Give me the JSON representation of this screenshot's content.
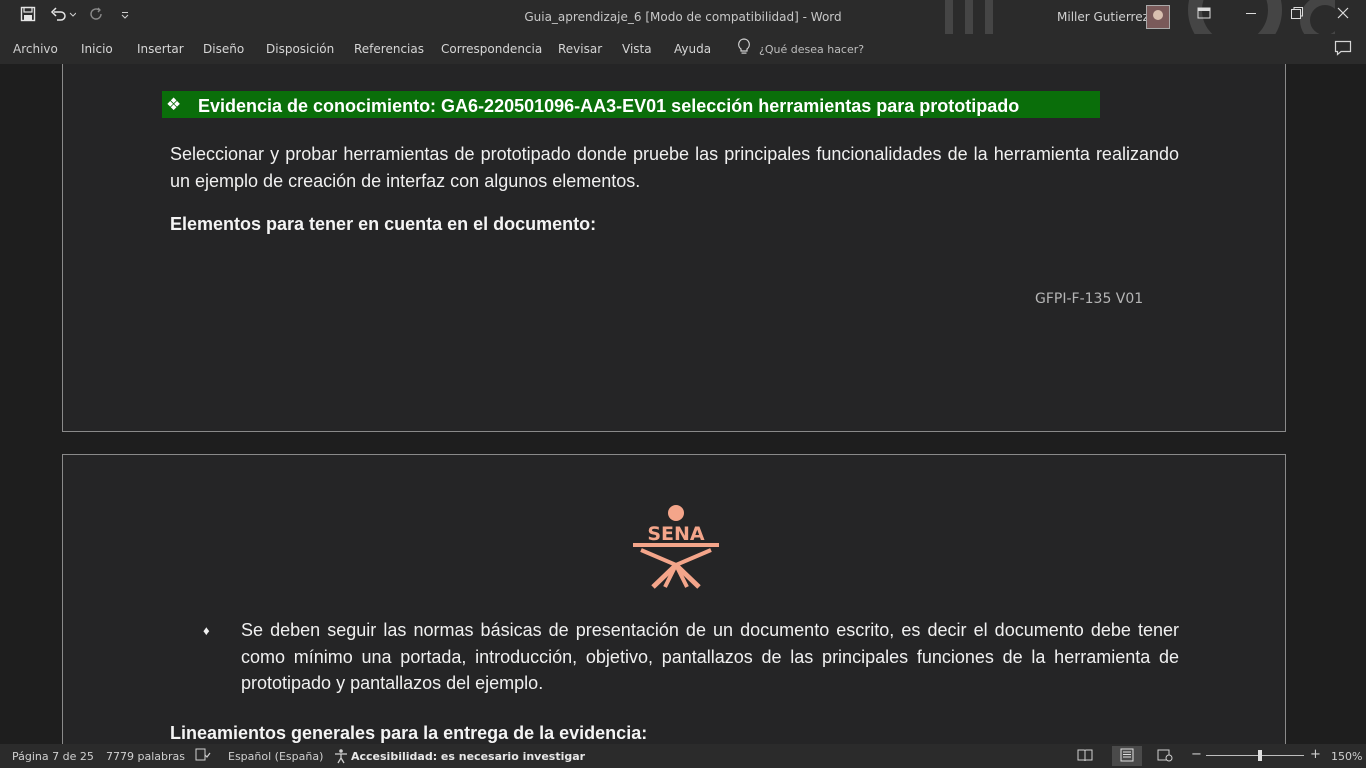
{
  "window": {
    "title": "Guia_aprendizaje_6 [Modo de compatibilidad]  -  Word",
    "user_name": "Miller Gutierrez"
  },
  "quick_access": {
    "save_icon": "save-icon",
    "undo_icon": "undo-icon",
    "redo_icon": "redo-icon",
    "customize_icon": "customize-icon"
  },
  "ribbon": {
    "tabs": [
      "Archivo",
      "Inicio",
      "Insertar",
      "Diseño",
      "Disposición",
      "Referencias",
      "Correspondencia",
      "Revisar",
      "Vista",
      "Ayuda"
    ],
    "tell_me": "¿Qué desea hacer?"
  },
  "document": {
    "page1": {
      "heading_bullet": "❖",
      "heading": "Evidencia de conocimiento: GA6-220501096-AA3-EV01 selección herramientas para prototipado",
      "paragraph": "Seleccionar y probar herramientas de prototipado donde pruebe las principales funcionalidades de la herramienta realizando un ejemplo de creación de interfaz con algunos elementos.",
      "subheading": "Elementos para tener en cuenta en el documento:",
      "footer_code": "GFPI-F-135 V01"
    },
    "page2": {
      "logo_text": "SENA",
      "bullet_glyph": "♦",
      "bullet_text": "Se deben seguir las normas básicas de presentación de un documento escrito, es decir el documento debe tener como mínimo una portada, introducción, objetivo, pantallazos de las principales funciones de la herramienta de prototipado y pantallazos del ejemplo.",
      "subheading": "Lineamientos generales para la entrega de la evidencia:"
    }
  },
  "status_bar": {
    "page": "Página 7 de 25",
    "words": "7779 palabras",
    "language": "Español (España)",
    "accessibility": "Accesibilidad: es necesario investigar",
    "zoom_minus": "−",
    "zoom_plus": "+",
    "zoom_level": "150%"
  },
  "colors": {
    "heading_highlight": "#0a6e0a",
    "logo": "#f4a58a"
  }
}
